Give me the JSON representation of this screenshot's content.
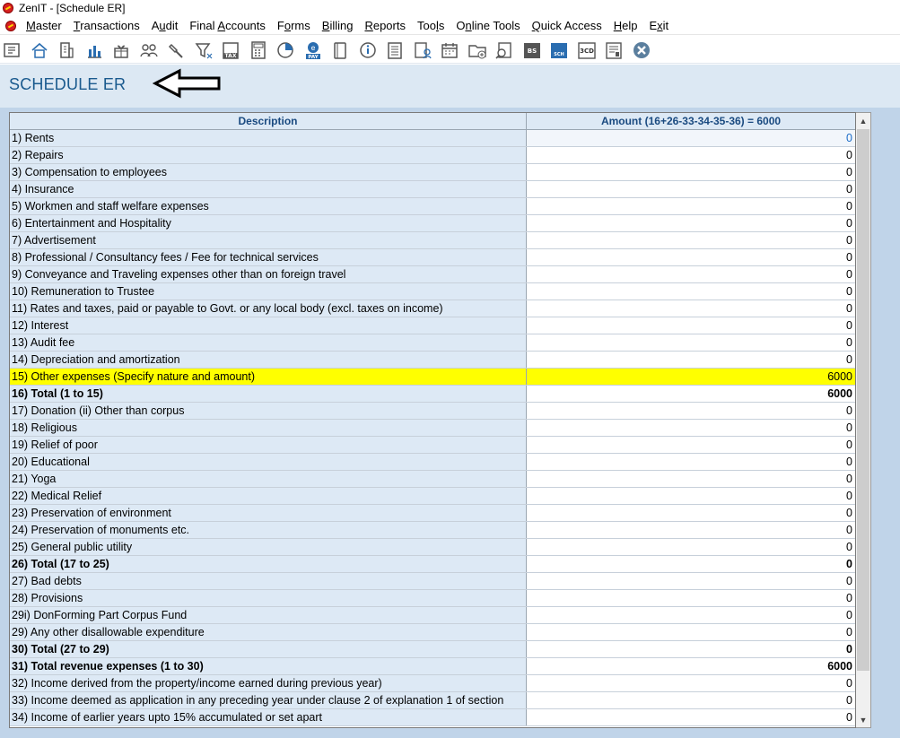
{
  "window": {
    "title": "ZenIT - [Schedule ER]"
  },
  "menu": {
    "items": [
      {
        "pre": "",
        "u": "M",
        "post": "aster"
      },
      {
        "pre": "",
        "u": "T",
        "post": "ransactions"
      },
      {
        "pre": "A",
        "u": "u",
        "post": "dit"
      },
      {
        "pre": "Final ",
        "u": "A",
        "post": "ccounts"
      },
      {
        "pre": "F",
        "u": "o",
        "post": "rms"
      },
      {
        "pre": "",
        "u": "B",
        "post": "illing"
      },
      {
        "pre": "",
        "u": "R",
        "post": "eports"
      },
      {
        "pre": "Too",
        "u": "l",
        "post": "s"
      },
      {
        "pre": "O",
        "u": "n",
        "post": "line Tools"
      },
      {
        "pre": "",
        "u": "Q",
        "post": "uick Access"
      },
      {
        "pre": "",
        "u": "H",
        "post": "elp"
      },
      {
        "pre": "E",
        "u": "x",
        "post": "it"
      }
    ]
  },
  "toolbar": {
    "icons": [
      "voucher-icon",
      "home-icon",
      "company-icon",
      "chart-icon",
      "gift-icon",
      "users-icon",
      "hammer-icon",
      "filter-icon",
      "tax-icon",
      "calculator-icon",
      "pie-icon",
      "epay-icon",
      "book-icon",
      "info-icon",
      "ledger-icon",
      "user-report-icon",
      "calendar-icon",
      "folder-add-icon",
      "search-doc-icon",
      "bs-icon",
      "bs-sch-icon",
      "3cd-icon",
      "form-icon",
      "close-icon"
    ],
    "tax_label": "TAX",
    "pay_label": "PAY",
    "bs_label": "BS",
    "sch_label": "SCH",
    "cd_label": "3CD"
  },
  "page": {
    "title": "SCHEDULE ER"
  },
  "colors": {
    "highlight": "#ffff00",
    "header_text": "#1a4a80",
    "title": "#1a5a8e"
  },
  "grid": {
    "columns": {
      "description": "Description",
      "amount": "Amount (16+26-33-34-35-36) = 6000"
    },
    "rows": [
      {
        "desc": "1) Rents",
        "amt": "0",
        "style": "selected"
      },
      {
        "desc": "2) Repairs",
        "amt": "0",
        "style": ""
      },
      {
        "desc": "3) Compensation to employees",
        "amt": "0",
        "style": ""
      },
      {
        "desc": "4) Insurance",
        "amt": "0",
        "style": ""
      },
      {
        "desc": "5) Workmen and staff welfare expenses",
        "amt": "0",
        "style": ""
      },
      {
        "desc": "6) Entertainment and Hospitality",
        "amt": "0",
        "style": ""
      },
      {
        "desc": "7) Advertisement",
        "amt": "0",
        "style": ""
      },
      {
        "desc": "8) Professional / Consultancy fees / Fee for technical services",
        "amt": "0",
        "style": ""
      },
      {
        "desc": "9) Conveyance and Traveling expenses other than on foreign travel",
        "amt": "0",
        "style": ""
      },
      {
        "desc": "10) Remuneration to Trustee",
        "amt": "0",
        "style": ""
      },
      {
        "desc": "11) Rates and taxes, paid or payable to Govt. or any local body (excl. taxes on income)",
        "amt": "0",
        "style": ""
      },
      {
        "desc": "12) Interest",
        "amt": "0",
        "style": ""
      },
      {
        "desc": "13) Audit fee",
        "amt": "0",
        "style": ""
      },
      {
        "desc": "14) Depreciation and amortization",
        "amt": "0",
        "style": ""
      },
      {
        "desc": "15) Other expenses  (Specify nature and amount)",
        "amt": "6000",
        "style": "highlight"
      },
      {
        "desc": "16) Total (1 to 15)",
        "amt": "6000",
        "style": "bold"
      },
      {
        "desc": "17) Donation (ii) Other than corpus",
        "amt": "0",
        "style": ""
      },
      {
        "desc": "18) Religious",
        "amt": "0",
        "style": ""
      },
      {
        "desc": "19) Relief of poor",
        "amt": "0",
        "style": ""
      },
      {
        "desc": "20) Educational",
        "amt": "0",
        "style": ""
      },
      {
        "desc": "21) Yoga",
        "amt": "0",
        "style": ""
      },
      {
        "desc": "22) Medical Relief",
        "amt": "0",
        "style": ""
      },
      {
        "desc": "23) Preservation of environment",
        "amt": "0",
        "style": ""
      },
      {
        "desc": "24) Preservation of monuments etc.",
        "amt": "0",
        "style": ""
      },
      {
        "desc": "25) General public utility",
        "amt": "0",
        "style": ""
      },
      {
        "desc": "26) Total (17 to 25)",
        "amt": "0",
        "style": "bold"
      },
      {
        "desc": "27) Bad debts",
        "amt": "0",
        "style": ""
      },
      {
        "desc": "28) Provisions",
        "amt": "0",
        "style": ""
      },
      {
        "desc": "29i) DonForming Part Corpus Fund",
        "amt": "0",
        "style": ""
      },
      {
        "desc": "29) Any other disallowable expenditure",
        "amt": "0",
        "style": ""
      },
      {
        "desc": "30) Total (27 to 29)",
        "amt": "0",
        "style": "bold"
      },
      {
        "desc": "31) Total revenue expenses (1 to 30)",
        "amt": "6000",
        "style": "bold"
      },
      {
        "desc": "32) Income derived from the property/income earned during previous year)",
        "amt": "0",
        "style": ""
      },
      {
        "desc": "33) Income deemed as application in any preceding year under clause 2 of explanation 1 of section",
        "amt": "0",
        "style": ""
      },
      {
        "desc": "34) Income of earlier years upto 15% accumulated or set apart",
        "amt": "0",
        "style": ""
      }
    ]
  }
}
